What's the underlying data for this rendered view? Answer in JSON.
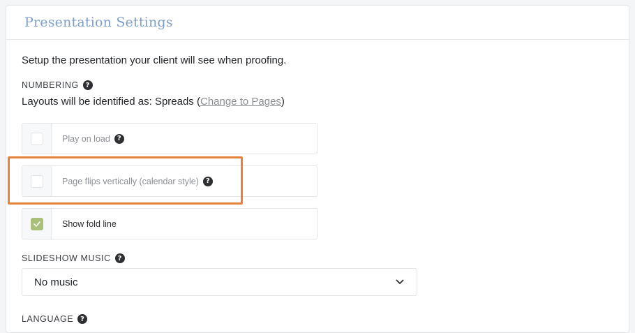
{
  "panel": {
    "title": "Presentation Settings",
    "intro": "Setup the presentation your client will see when proofing."
  },
  "numbering": {
    "label": "NUMBERING",
    "help_icon": "question-circle-icon",
    "text_prefix": "Layouts will be identified as: Spreads (",
    "link": "Change to Pages",
    "text_suffix": ")"
  },
  "options": [
    {
      "label": "Play on load",
      "checked": false,
      "has_help": true
    },
    {
      "label": "Page flips vertically (calendar style)",
      "checked": false,
      "has_help": true
    },
    {
      "label": "Show fold line",
      "checked": true,
      "has_help": false
    }
  ],
  "slideshow_music": {
    "label": "SLIDESHOW MUSIC",
    "selected": "No music",
    "dropdown_icon": "chevron-down-icon"
  },
  "language": {
    "label": "LANGUAGE"
  },
  "colors": {
    "title": "#7f9fc4",
    "highlight": "#e8823b",
    "checked": "#a9c07a"
  }
}
